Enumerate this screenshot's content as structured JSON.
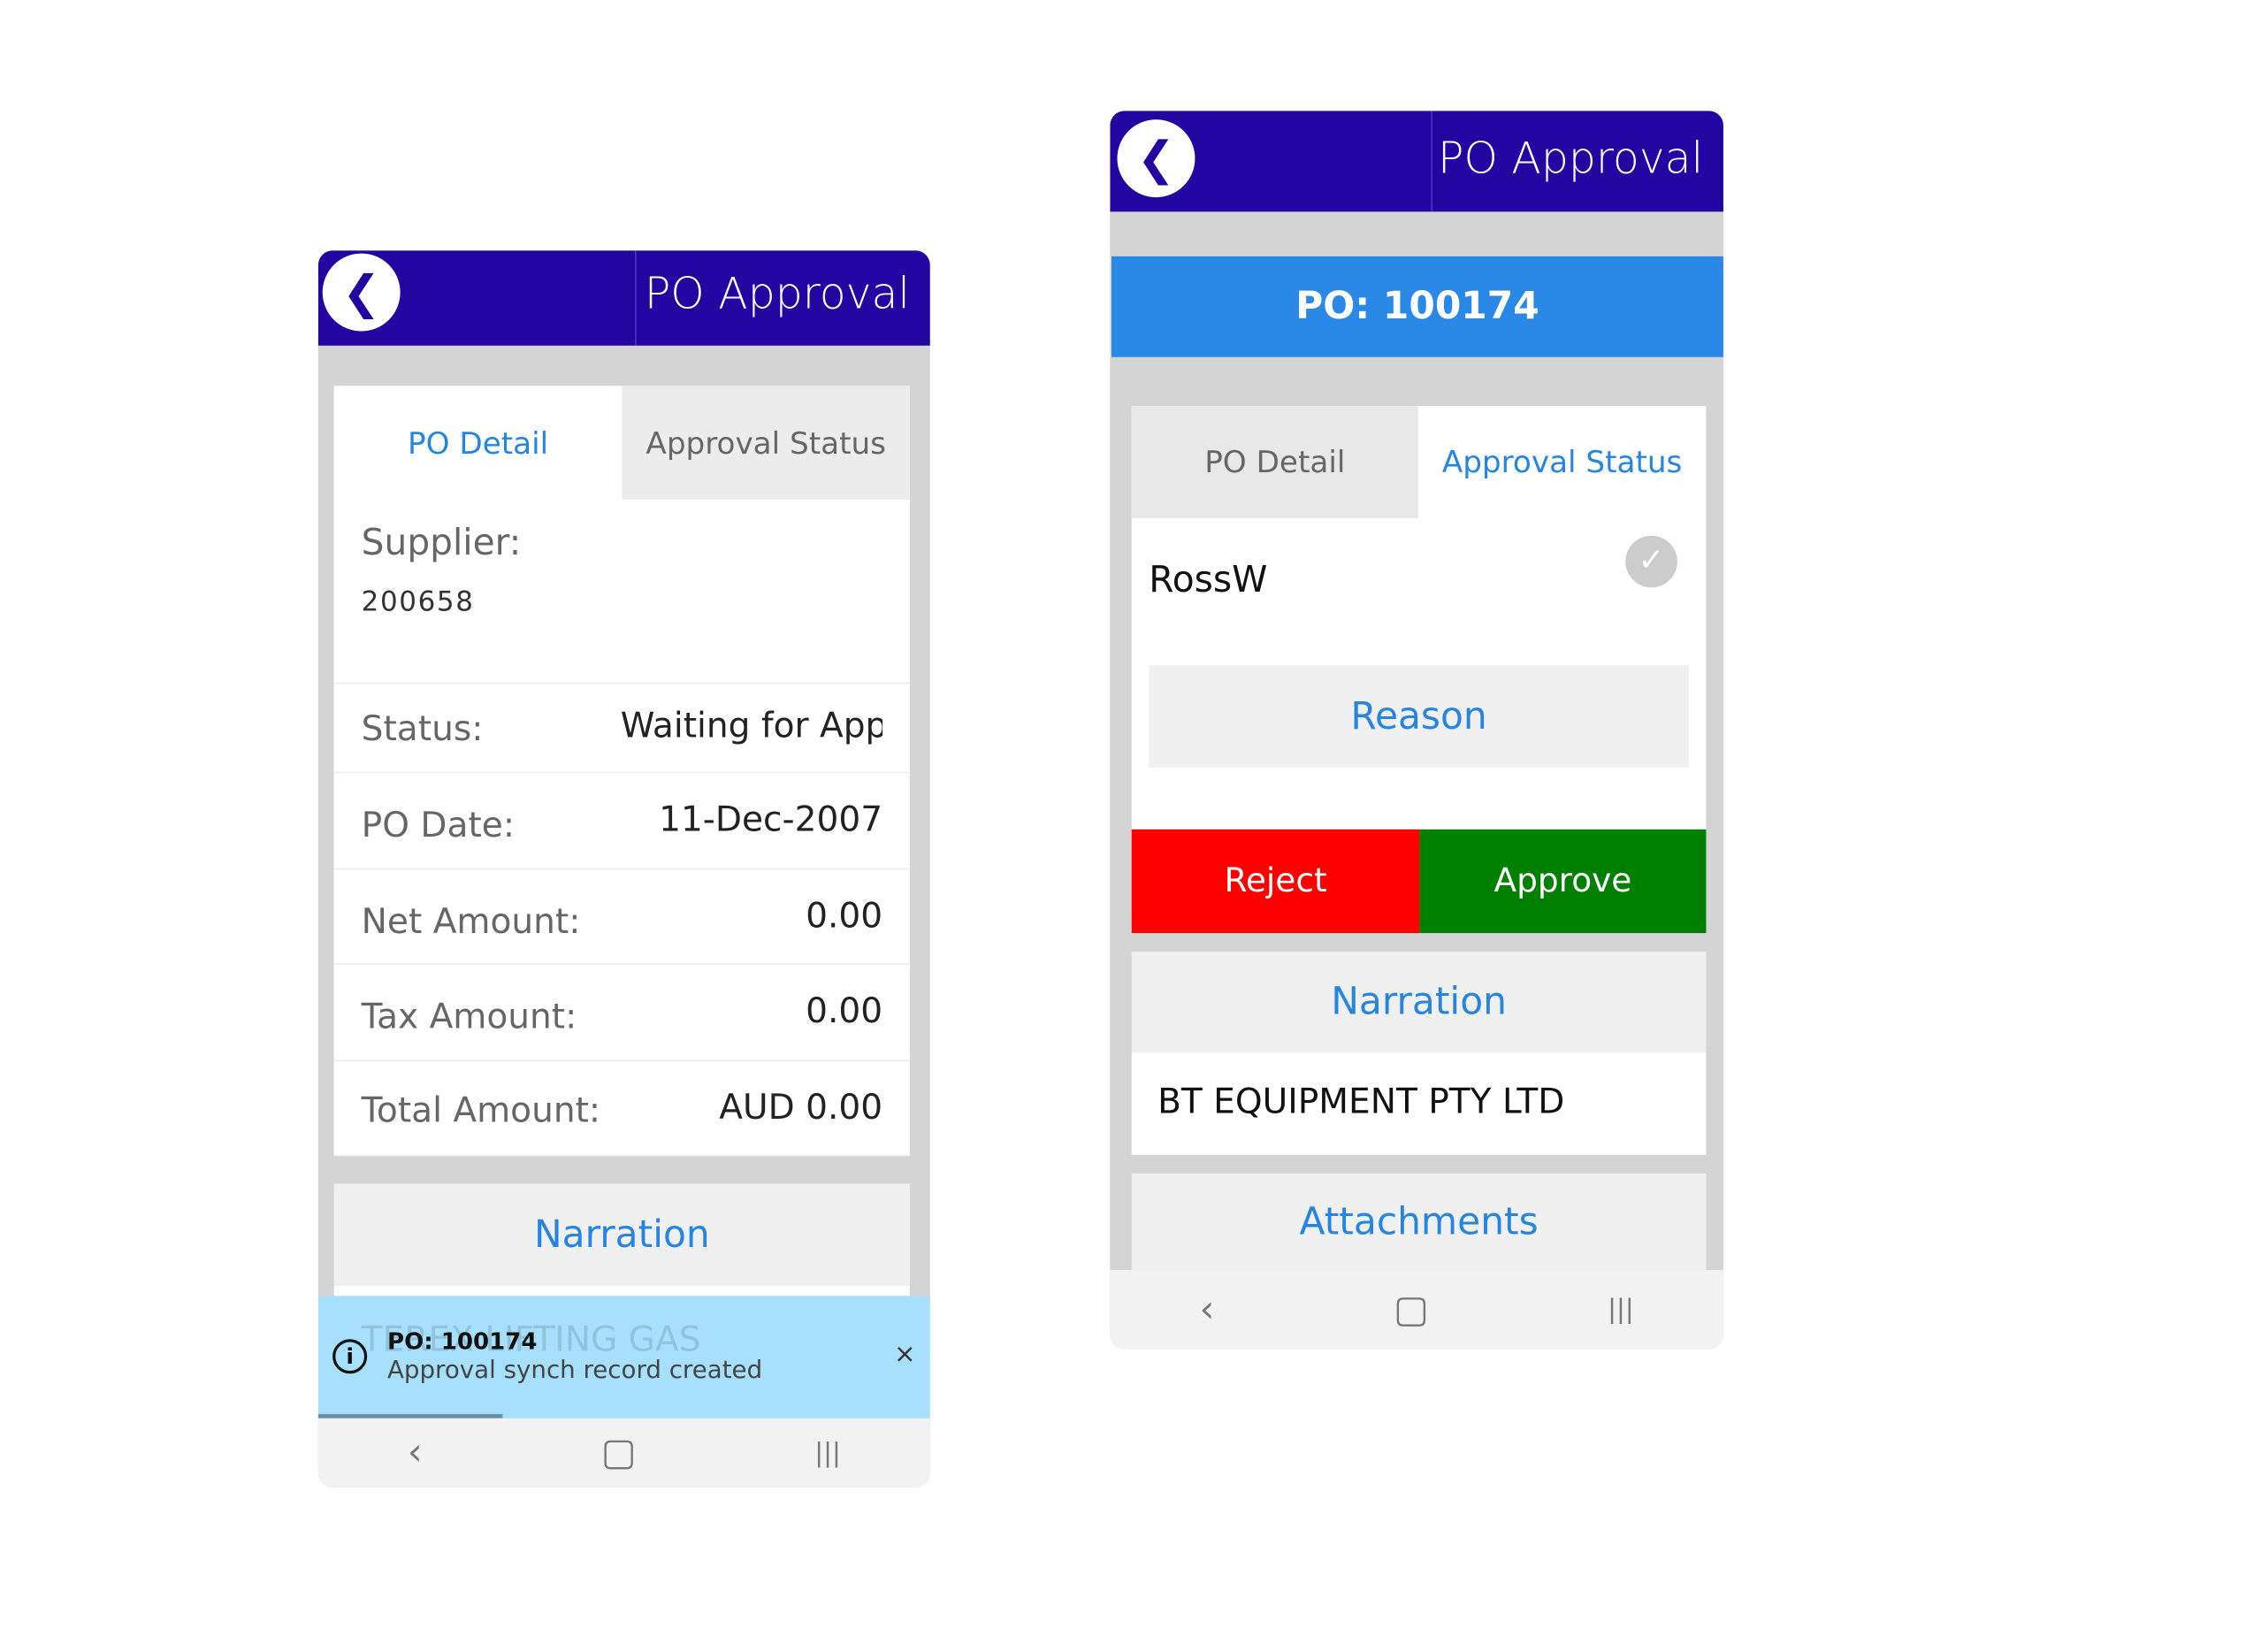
{
  "left_screen": {
    "header": {
      "title": "PO Approval",
      "back_icon": "chevron-left-icon"
    },
    "tabs": [
      {
        "label": "PO Detail",
        "active": true
      },
      {
        "label": "Approval Status",
        "active": false
      }
    ],
    "supplier": {
      "label": "Supplier:",
      "value": "200658"
    },
    "fields": [
      {
        "label": "Status:",
        "value": "Waiting for Appr"
      },
      {
        "label": "PO Date:",
        "value": "11-Dec-2007"
      },
      {
        "label": "Net Amount:",
        "value": "0.00"
      },
      {
        "label": "Tax Amount:",
        "value": "0.00"
      },
      {
        "label": "Total Amount:",
        "value": "AUD 0.00"
      }
    ],
    "narration_label": "Narration",
    "narration_value": "TEREX LIFTING GAS",
    "toast": {
      "title": "PO: 100174",
      "message": "Approval synch record created",
      "icon": "info-icon",
      "close": "×",
      "progress": 0.3
    },
    "nav": {
      "back": "‹",
      "home": "▢",
      "recents": "|||"
    }
  },
  "right_screen": {
    "header": {
      "title": "PO Approval",
      "back_icon": "chevron-left-icon"
    },
    "po_banner": "PO: 100174",
    "tabs": [
      {
        "label": "PO Detail",
        "active": false
      },
      {
        "label": "Approval Status",
        "active": true
      }
    ],
    "approver": {
      "name": "RossW",
      "status_icon": "check-circle-icon"
    },
    "reason_label": "Reason",
    "reject_label": "Reject",
    "approve_label": "Approve",
    "narration_label": "Narration",
    "narration_value": "BT EQUIPMENT PTY LTD",
    "attachments_label": "Attachments",
    "nav": {
      "back": "‹",
      "home": "▢",
      "recents": "|||"
    }
  },
  "colors": {
    "header": "#2305a2",
    "accent": "#2585e0",
    "banner": "#2a88e6",
    "reject": "#ff0000",
    "approve": "#008000",
    "toast": "#a6e0fc"
  }
}
